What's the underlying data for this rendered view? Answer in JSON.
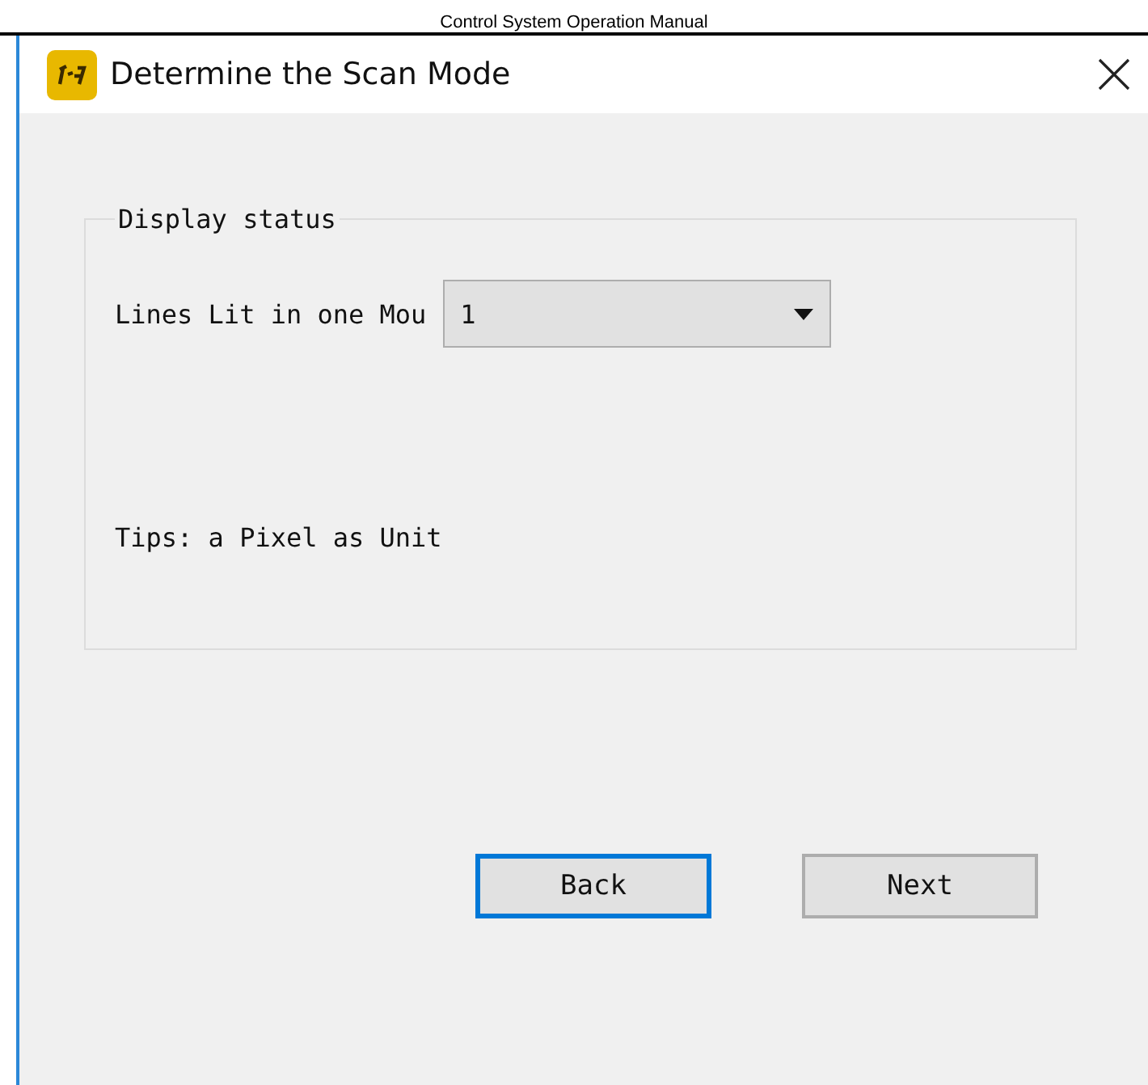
{
  "page_header": "Control System Operation Manual",
  "window": {
    "title": "Determine the Scan Mode"
  },
  "group": {
    "title": "Display status",
    "field_label": "Lines Lit in one Mou",
    "dropdown": {
      "value": "1"
    },
    "tip": "Tips: a Pixel as Unit"
  },
  "buttons": [
    {
      "label": "Back",
      "focused": true
    },
    {
      "label": "Next",
      "focused": false
    }
  ]
}
